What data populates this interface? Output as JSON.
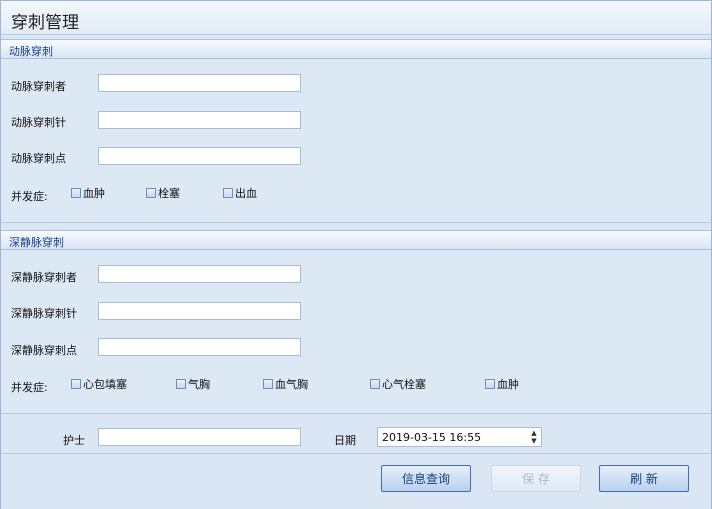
{
  "title": "穿刺管理",
  "arterial": {
    "header": "动脉穿刺",
    "fields": [
      "动脉穿刺者",
      "动脉穿刺针",
      "动脉穿刺点"
    ],
    "complication_label": "并发症:",
    "complications": [
      "血肿",
      "栓塞",
      "出血"
    ]
  },
  "venous": {
    "header": "深静脉穿刺",
    "fields": [
      "深静脉穿刺者",
      "深静脉穿刺针",
      "深静脉穿刺点"
    ],
    "complication_label": "并发症:",
    "complications": [
      "心包填塞",
      "气胸",
      "血气胸",
      "心气栓塞",
      "血肿"
    ]
  },
  "footer": {
    "nurse_label": "护士",
    "date_label": "日期",
    "date_value": "2019-03-15 16:55"
  },
  "buttons": {
    "query": "信息查询",
    "save": "保 存",
    "refresh": "刷 新"
  }
}
